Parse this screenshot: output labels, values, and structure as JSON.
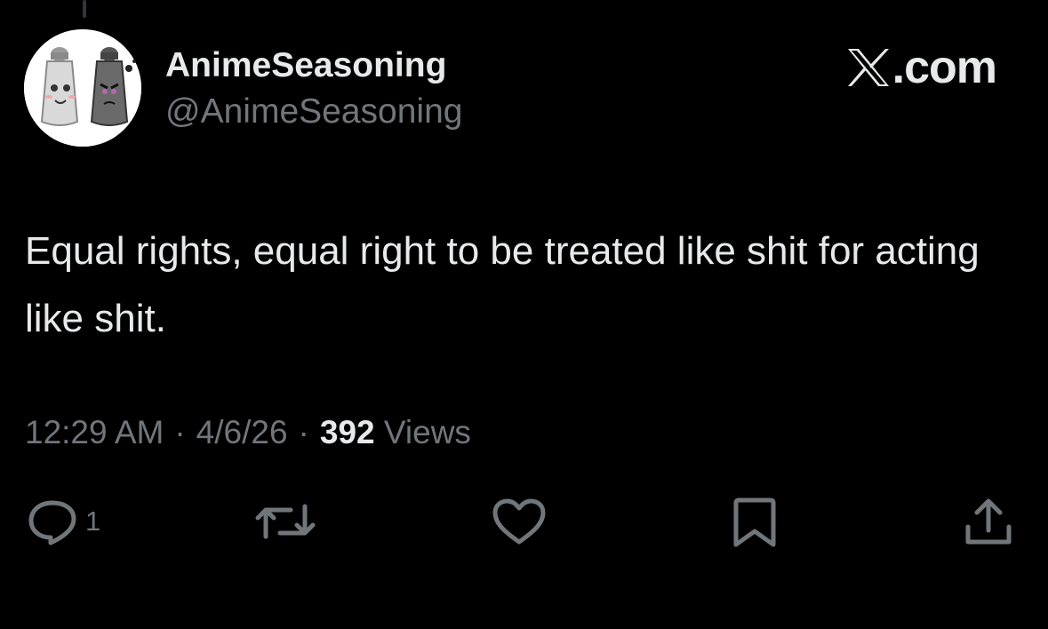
{
  "tweet": {
    "author": {
      "display_name": "AnimeSeasoning",
      "handle": "@AnimeSeasoning",
      "avatar": "salt-and-pepper-shakers-avatar"
    },
    "brand": {
      "icon": "x-logo-icon",
      "text": ".com"
    },
    "text": "Equal rights, equal right to be treated like shit for acting like shit.",
    "meta": {
      "time": "12:29 AM",
      "separator": "·",
      "date": "4/6/26",
      "views_count": "392",
      "views_label": "Views"
    },
    "actions": {
      "reply": {
        "icon": "reply-icon",
        "count": "1"
      },
      "retweet": {
        "icon": "retweet-icon"
      },
      "like": {
        "icon": "heart-icon"
      },
      "bookmark": {
        "icon": "bookmark-icon"
      },
      "share": {
        "icon": "share-icon"
      }
    }
  },
  "colors": {
    "background": "#000000",
    "primary_text": "#e7e9ea",
    "secondary_text": "#71767b"
  }
}
